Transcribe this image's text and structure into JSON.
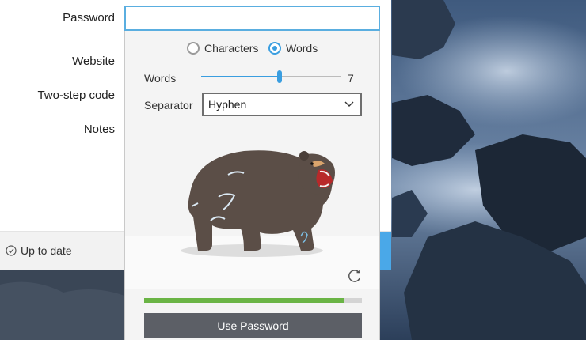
{
  "form": {
    "labels": {
      "password": "Password",
      "website": "Website",
      "two_step": "Two-step code",
      "notes": "Notes"
    },
    "password_value": ""
  },
  "status": {
    "text": "Up to date",
    "icon": "check-circle-icon"
  },
  "generator": {
    "modes": [
      {
        "label": "Characters",
        "selected": false
      },
      {
        "label": "Words",
        "selected": true
      }
    ],
    "words": {
      "label": "Words",
      "value": "7",
      "slider_fraction": 0.56
    },
    "separator": {
      "label": "Separator",
      "value": "Hyphen"
    },
    "illustration": "roaring-bear",
    "refresh_icon": "refresh-icon",
    "strength": {
      "fraction": 0.92,
      "color": "#6ab445"
    },
    "use_button": "Use Password"
  },
  "colors": {
    "accent": "#3a9ee0",
    "button": "#5c5f66"
  }
}
